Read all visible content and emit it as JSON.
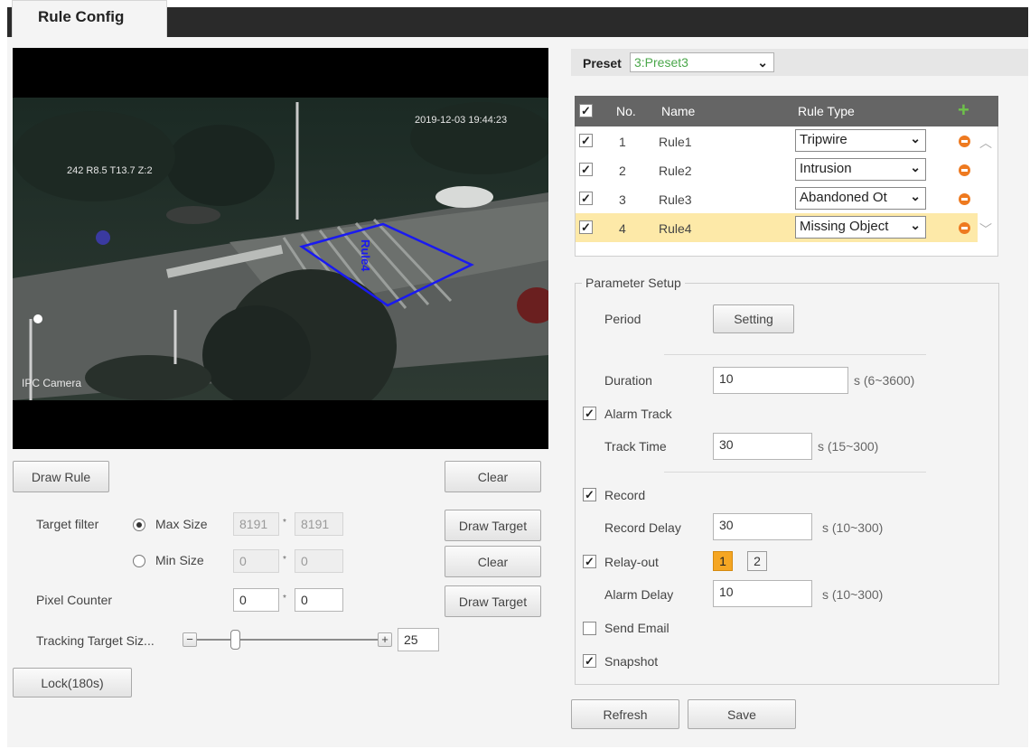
{
  "tab": {
    "title": "Rule Config"
  },
  "video": {
    "timestamp": "2019-12-03 19:44:23",
    "overlay_info": "242 R8.5 T13.7 Z:2",
    "camera_label": "IPC Camera",
    "rule_label": "Rule4",
    "rule_color": "#1a1af0"
  },
  "left": {
    "draw_rule": "Draw Rule",
    "clear": "Clear",
    "target_filter_label": "Target filter",
    "max_size_label": "Max Size",
    "max_w": "8191",
    "max_h": "8191",
    "min_size_label": "Min Size",
    "min_w": "0",
    "min_h": "0",
    "draw_target": "Draw Target",
    "clear2": "Clear",
    "pixel_counter_label": "Pixel Counter",
    "pixel_w": "0",
    "pixel_h": "0",
    "draw_target2": "Draw Target",
    "tracking_label": "Tracking Target Siz...",
    "tracking_value": "25",
    "lock": "Lock(180s)",
    "size_separator": "*"
  },
  "preset": {
    "label": "Preset",
    "value": "3:Preset3"
  },
  "rules": {
    "headers": {
      "no": "No.",
      "name": "Name",
      "type": "Rule Type"
    },
    "rows": [
      {
        "no": "1",
        "name": "Rule1",
        "type": "Tripwire",
        "checked": true
      },
      {
        "no": "2",
        "name": "Rule2",
        "type": "Intrusion",
        "checked": true
      },
      {
        "no": "3",
        "name": "Rule3",
        "type": "Abandoned Ot",
        "checked": true
      },
      {
        "no": "4",
        "name": "Rule4",
        "type": "Missing Object",
        "checked": true,
        "selected": true
      }
    ]
  },
  "params": {
    "legend": "Parameter Setup",
    "period_label": "Period",
    "setting_btn": "Setting",
    "duration_label": "Duration",
    "duration_value": "10",
    "duration_hint": "s (6~3600)",
    "alarm_track_label": "Alarm Track",
    "track_time_label": "Track Time",
    "track_time_value": "30",
    "track_time_hint": "s (15~300)",
    "record_label": "Record",
    "record_delay_label": "Record Delay",
    "record_delay_value": "30",
    "record_delay_hint": "s (10~300)",
    "relay_out_label": "Relay-out",
    "relay_1": "1",
    "relay_2": "2",
    "alarm_delay_label": "Alarm Delay",
    "alarm_delay_value": "10",
    "alarm_delay_hint": "s (10~300)",
    "send_email_label": "Send Email",
    "snapshot_label": "Snapshot"
  },
  "footer": {
    "refresh": "Refresh",
    "save": "Save"
  }
}
